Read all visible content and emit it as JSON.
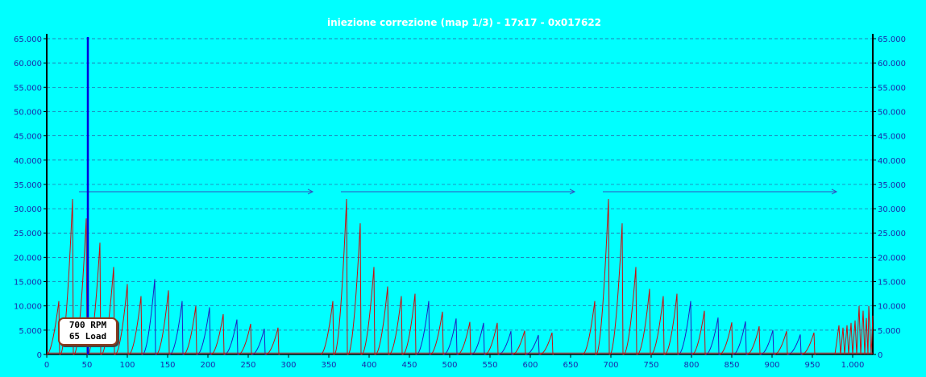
{
  "chart_data": {
    "type": "line",
    "title": "iniezione correzione (map 1/3) - 17x17 - 0x017622",
    "xlim": [
      0,
      1025
    ],
    "ylim": [
      0,
      65000
    ],
    "x_ticks": [
      0,
      50,
      100,
      150,
      200,
      250,
      300,
      350,
      400,
      450,
      500,
      550,
      600,
      650,
      700,
      750,
      800,
      850,
      900,
      950,
      1000
    ],
    "x_tick_labels": [
      "0",
      "50",
      "100",
      "150",
      "200",
      "250",
      "300",
      "350",
      "400",
      "450",
      "500",
      "550",
      "600",
      "650",
      "700",
      "750",
      "800",
      "850",
      "900",
      "950",
      "1.000"
    ],
    "y_ticks": [
      0,
      5000,
      10000,
      15000,
      20000,
      25000,
      30000,
      35000,
      40000,
      45000,
      50000,
      55000,
      60000,
      65000
    ],
    "y_tick_labels_left": [
      "0",
      "5.000",
      "10.000",
      "15.000",
      "20.000",
      "25.000",
      "30.000",
      "35.000",
      "40.000",
      "45.000",
      "50.000",
      "55.000",
      "60.000",
      "65.000"
    ],
    "y_tick_labels_right": [
      "0",
      "5.000",
      "10.000",
      "15.000",
      "20.000",
      "25.000",
      "30.000",
      "35.000",
      "40.000",
      "45.000",
      "50.000",
      "55.000",
      "60.000",
      "65.000"
    ],
    "grid": true,
    "cursor": {
      "x": 51,
      "rpm_label": "700 RPM",
      "load_label": "65 Load",
      "color": "#0000e0"
    },
    "arrows": [
      {
        "x_start": 40,
        "x_end": 330,
        "y": 33500
      },
      {
        "x_start": 365,
        "x_end": 655,
        "y": 33500
      },
      {
        "x_start": 690,
        "x_end": 980,
        "y": 33500
      }
    ],
    "series_color": "#c81010",
    "series_alt_color": "#2020c0",
    "blocks": [
      {
        "start": 0,
        "peaks": [
          11000,
          32000,
          28000,
          23000,
          18000,
          14500,
          12000,
          15500,
          13200,
          11000,
          10000,
          9700,
          8300,
          7200,
          6300,
          5300,
          5500
        ]
      },
      {
        "start": 340,
        "peaks": [
          11000,
          32000,
          27000,
          18000,
          14000,
          12000,
          12500,
          11000,
          8800,
          7400,
          6700,
          6500,
          6500,
          4800,
          4900,
          4000,
          4500
        ]
      },
      {
        "start": 665,
        "peaks": [
          11000,
          32000,
          27000,
          18000,
          13500,
          12000,
          12500,
          11000,
          9000,
          7600,
          6600,
          6800,
          5800,
          5000,
          4800,
          4100,
          4500
        ]
      }
    ],
    "tail": {
      "x": [
        978,
        983,
        985,
        988,
        990,
        993,
        995,
        998,
        1000,
        1003,
        1005,
        1008,
        1010,
        1013,
        1015,
        1017,
        1019,
        1020,
        1023,
        1025
      ],
      "y": [
        0,
        6000,
        0,
        5500,
        0,
        6000,
        0,
        6500,
        0,
        7000,
        0,
        10000,
        0,
        9000,
        0,
        7500,
        0,
        10000,
        0,
        8000
      ]
    },
    "colors": {
      "background": "#00ffff",
      "grid": "#2a5aa0",
      "axis": "#000000",
      "tick_text": "#1a2aa8",
      "title": "#ffffff",
      "arrow": "#3050c0"
    }
  }
}
